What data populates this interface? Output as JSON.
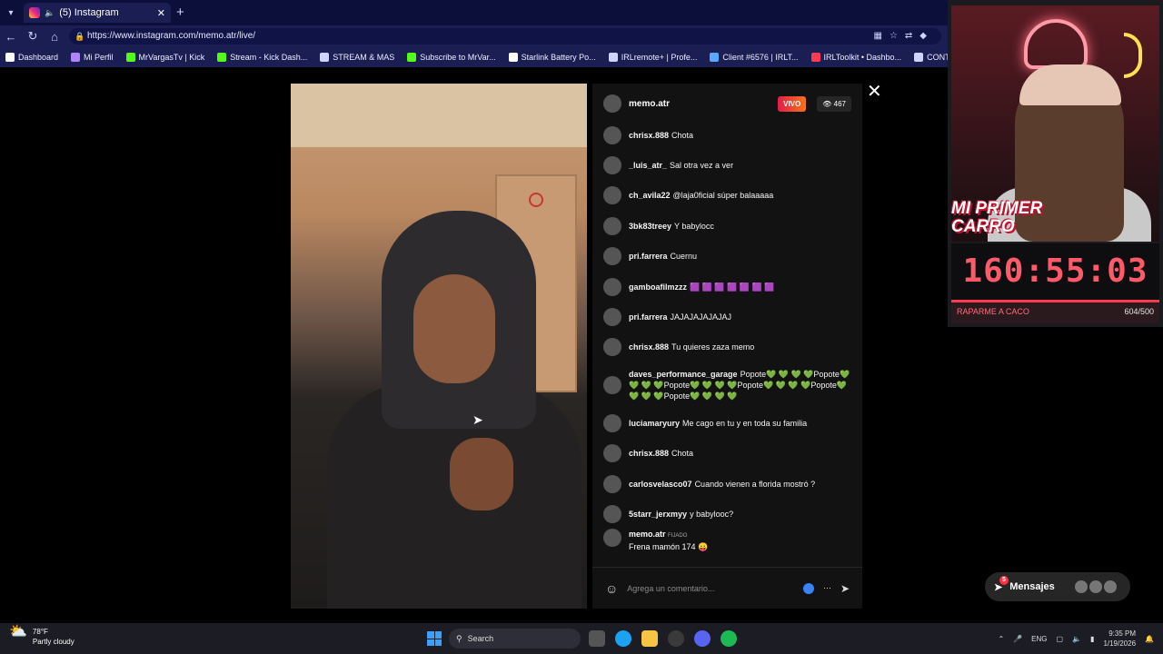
{
  "browser": {
    "tab_title": "(5) Instagram",
    "url": "https://www.instagram.com/memo.atr/live/",
    "bookmarks": [
      {
        "label": "Dashboard",
        "color": "#ffffff"
      },
      {
        "label": "Mi Perfil",
        "color": "#b084ff"
      },
      {
        "label": "MrVargasTv | Kick",
        "color": "#53fc18"
      },
      {
        "label": "Stream - Kick Dash...",
        "color": "#53fc18"
      },
      {
        "label": "STREAM & MAS",
        "color": "#cfd3ff"
      },
      {
        "label": "Subscribe to MrVar...",
        "color": "#53fc18"
      },
      {
        "label": "Starlink Battery Po...",
        "color": "#ffffff"
      },
      {
        "label": "IRLremote+ | Profe...",
        "color": "#cfd3ff"
      },
      {
        "label": "Client #6576 | IRLT...",
        "color": "#5aa9ff"
      },
      {
        "label": "IRLToolkit • Dashbo...",
        "color": "#ff3b52"
      },
      {
        "label": "CONTADOR",
        "color": "#cfd3ff"
      }
    ]
  },
  "live": {
    "username": "memo.atr",
    "live_badge": "VIVO",
    "viewers": "467",
    "comments": [
      {
        "user": "chrisx.888",
        "text": "Chota"
      },
      {
        "user": "_luis_atr_",
        "text": "Sal otra vez a ver"
      },
      {
        "user": "ch_avila22",
        "text": "@laja0ficial súper balaaaaa"
      },
      {
        "user": "3bk83treey",
        "text": "Y babylocc"
      },
      {
        "user": "pri.farrera",
        "text": "Cuernu"
      },
      {
        "user": "gamboafilmzzz",
        "text": "🟪 🟪 🟪 🟪 🟪 🟪 🟪"
      },
      {
        "user": "pri.farrera",
        "text": "JAJAJAJAJAJAJ"
      },
      {
        "user": "chrisx.888",
        "text": "Tu quieres zaza memo"
      },
      {
        "user": "daves_performance_garage",
        "text": "Popote💚 💚 💚 💚Popote💚 💚 💚 💚Popote💚 💚 💚 💚Popote💚 💚 💚 💚Popote💚 💚 💚 💚Popote💚 💚 💚 💚",
        "multi": true
      },
      {
        "user": "luciamaryury",
        "text": "Me cago en tu y en toda su familia"
      },
      {
        "user": "chrisx.888",
        "text": "Chota"
      },
      {
        "user": "carlosvelasco07",
        "text": "Cuando vienen a florida mostró ?"
      },
      {
        "user": "5starr_jerxmyy",
        "text": "y babylooc?"
      }
    ],
    "pinned": {
      "user": "memo.atr",
      "label": "FIJADO",
      "text": "Frena mamón 174 😛"
    },
    "composer_placeholder": "Agrega un comentario...",
    "messages_label": "Mensajes",
    "messages_badge": "5"
  },
  "overlay": {
    "banner_line1": "MI PRIMER",
    "banner_line2": "CARRO",
    "timer": "160:55:03",
    "goal_label": "RAPARME A CACO",
    "goal_count": "604/500",
    "goal_progress": 1.0
  },
  "taskbar": {
    "temp": "78°F",
    "weather": "Partly cloudy",
    "search": "Search",
    "lang": "ENG",
    "time": "9:35 PM",
    "date": "1/19/2026"
  }
}
